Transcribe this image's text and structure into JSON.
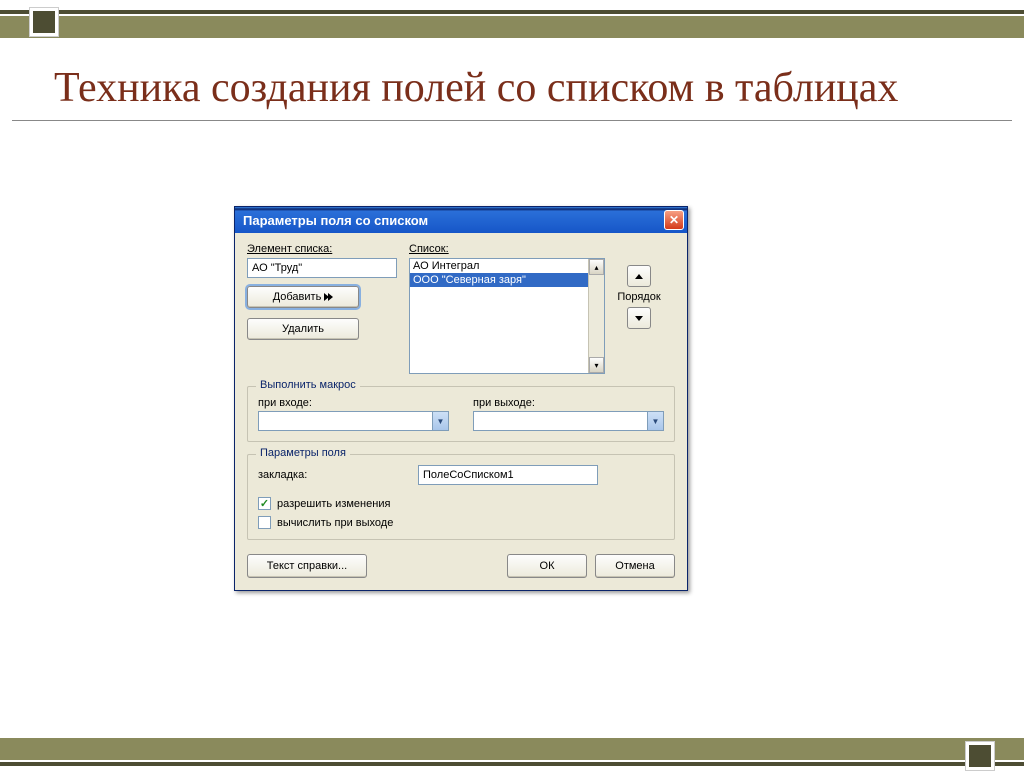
{
  "slide": {
    "title": "Техника создания полей со списком в таблицах"
  },
  "dialog": {
    "title": "Параметры поля со списком",
    "element_label": "Элемент списка:",
    "element_value": "АО \"Труд\"",
    "list_label": "Список:",
    "list_items": {
      "item0": "АО Интеграл",
      "item1": "ООО \"Северная заря\""
    },
    "add_label": "Добавить",
    "delete_label": "Удалить",
    "order_label": "Порядок",
    "macro_group": "Выполнить макрос",
    "macro_entry": "при входе:",
    "macro_exit": "при выходе:",
    "field_group": "Параметры поля",
    "bookmark_label": "закладка:",
    "bookmark_value": "ПолеСоСписком1",
    "allow_changes": "разрешить изменения",
    "calc_on_exit": "вычислить при выходе",
    "help_label": "Текст справки...",
    "ok_label": "ОК",
    "cancel_label": "Отмена"
  }
}
